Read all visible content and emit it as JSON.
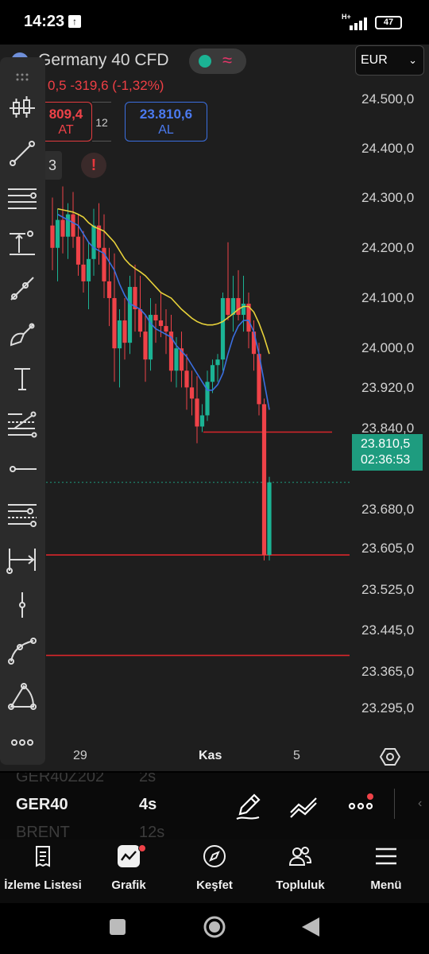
{
  "status_bar": {
    "time": "14:23",
    "network": "H+",
    "battery": "47"
  },
  "instrument": {
    "name": "Germany 40 CFD",
    "change": "0,5  -319,6 (-1,32%)",
    "sell_price": "809,4",
    "sell_label": "AT",
    "spread": "12",
    "buy_price": "23.810,6",
    "buy_label": "AL",
    "chip": "3",
    "alert": "!"
  },
  "currency": {
    "selected": "EUR"
  },
  "price_axis": {
    "labels": [
      "24.500,0",
      "24.400,0",
      "24.300,0",
      "24.200,0",
      "24.100,0",
      "24.000,0",
      "23.920,0",
      "23.840,0",
      "23.680,0",
      "23.605,0",
      "23.525,0",
      "23.445,0",
      "23.365,0",
      "23.295,0"
    ],
    "current_price": "23.810,5",
    "countdown": "02:36:53"
  },
  "time_axis": {
    "labels": [
      "29",
      "Kas",
      "5"
    ]
  },
  "chart_data": {
    "type": "candlestick",
    "ylim": [
      23250,
      24560
    ],
    "candles": [
      {
        "o": 24270,
        "h": 24320,
        "l": 24190,
        "c": 24230
      },
      {
        "o": 24230,
        "h": 24300,
        "l": 24170,
        "c": 24280
      },
      {
        "o": 24280,
        "h": 24340,
        "l": 24220,
        "c": 24250
      },
      {
        "o": 24250,
        "h": 24310,
        "l": 24210,
        "c": 24290
      },
      {
        "o": 24290,
        "h": 24330,
        "l": 24230,
        "c": 24250
      },
      {
        "o": 24250,
        "h": 24290,
        "l": 24180,
        "c": 24200
      },
      {
        "o": 24200,
        "h": 24260,
        "l": 24150,
        "c": 24170
      },
      {
        "o": 24170,
        "h": 24240,
        "l": 24120,
        "c": 24210
      },
      {
        "o": 24210,
        "h": 24300,
        "l": 24180,
        "c": 24270
      },
      {
        "o": 24270,
        "h": 24310,
        "l": 24200,
        "c": 24230
      },
      {
        "o": 24230,
        "h": 24290,
        "l": 24140,
        "c": 24170
      },
      {
        "o": 24170,
        "h": 24230,
        "l": 24090,
        "c": 24140
      },
      {
        "o": 24140,
        "h": 24220,
        "l": 23990,
        "c": 24050
      },
      {
        "o": 24050,
        "h": 24120,
        "l": 23980,
        "c": 24100
      },
      {
        "o": 24100,
        "h": 24140,
        "l": 24030,
        "c": 24060
      },
      {
        "o": 24060,
        "h": 24180,
        "l": 24040,
        "c": 24160
      },
      {
        "o": 24160,
        "h": 24200,
        "l": 24080,
        "c": 24120
      },
      {
        "o": 24120,
        "h": 24180,
        "l": 24070,
        "c": 24080
      },
      {
        "o": 24080,
        "h": 24110,
        "l": 23990,
        "c": 24030
      },
      {
        "o": 24030,
        "h": 24140,
        "l": 24010,
        "c": 24110
      },
      {
        "o": 24110,
        "h": 24130,
        "l": 24060,
        "c": 24100
      },
      {
        "o": 24100,
        "h": 24150,
        "l": 24070,
        "c": 24090
      },
      {
        "o": 24090,
        "h": 24120,
        "l": 24040,
        "c": 24080
      },
      {
        "o": 24080,
        "h": 24110,
        "l": 23990,
        "c": 24010
      },
      {
        "o": 24010,
        "h": 24070,
        "l": 23980,
        "c": 24050
      },
      {
        "o": 24050,
        "h": 24080,
        "l": 23980,
        "c": 24010
      },
      {
        "o": 24010,
        "h": 24040,
        "l": 23940,
        "c": 23980
      },
      {
        "o": 23980,
        "h": 24010,
        "l": 23930,
        "c": 23960
      },
      {
        "o": 23960,
        "h": 24000,
        "l": 23880,
        "c": 23910
      },
      {
        "o": 23910,
        "h": 23950,
        "l": 23900,
        "c": 23930
      },
      {
        "o": 23930,
        "h": 24010,
        "l": 23920,
        "c": 23990
      },
      {
        "o": 23990,
        "h": 24030,
        "l": 23970,
        "c": 24020
      },
      {
        "o": 24020,
        "h": 24040,
        "l": 23990,
        "c": 24030
      },
      {
        "o": 24030,
        "h": 24150,
        "l": 24010,
        "c": 24140
      },
      {
        "o": 24140,
        "h": 24240,
        "l": 24100,
        "c": 24110
      },
      {
        "o": 24110,
        "h": 24180,
        "l": 24080,
        "c": 24140
      },
      {
        "o": 24140,
        "h": 24190,
        "l": 24100,
        "c": 24110
      },
      {
        "o": 24110,
        "h": 24180,
        "l": 24080,
        "c": 24130
      },
      {
        "o": 24130,
        "h": 24150,
        "l": 24050,
        "c": 24080
      },
      {
        "o": 24080,
        "h": 24100,
        "l": 24010,
        "c": 24040
      },
      {
        "o": 24040,
        "h": 24060,
        "l": 23930,
        "c": 23950
      },
      {
        "o": 23950,
        "h": 23960,
        "l": 23670,
        "c": 23680
      },
      {
        "o": 23680,
        "h": 23820,
        "l": 23670,
        "c": 23810
      }
    ],
    "ma_fast": [
      24290,
      24285,
      24280,
      24275,
      24270,
      24255,
      24240,
      24230,
      24225,
      24220,
      24205,
      24190,
      24165,
      24145,
      24130,
      24125,
      24120,
      24110,
      24095,
      24085,
      24080,
      24075,
      24070,
      24055,
      24045,
      24035,
      24020,
      24005,
      23990,
      23975,
      23975,
      23985,
      24005,
      24040,
      24070,
      24090,
      24100,
      24100,
      24080,
      24040,
      23990,
      23940
    ],
    "ma_slow": [
      24300,
      24298,
      24296,
      24294,
      24290,
      24285,
      24275,
      24268,
      24264,
      24260,
      24250,
      24240,
      24225,
      24210,
      24200,
      24193,
      24187,
      24180,
      24170,
      24160,
      24150,
      24145,
      24140,
      24130,
      24120,
      24112,
      24104,
      24098,
      24094,
      24092,
      24092,
      24094,
      24098,
      24105,
      24112,
      24120,
      24125,
      24125,
      24115,
      24095,
      24070,
      24040
    ],
    "hlines": [
      23900,
      23680,
      23500
    ],
    "current_price_line": 23810
  },
  "toolbar": {
    "more": "ooo"
  },
  "watchlist": {
    "rows": [
      {
        "symbol": "GER40Z202",
        "period": "2s"
      },
      {
        "symbol": "GER40",
        "period": "4s"
      },
      {
        "symbol": "BRENT",
        "period": "12s"
      }
    ]
  },
  "bottom_nav": {
    "items": [
      {
        "label": "İzleme Listesi",
        "icon": "list-icon"
      },
      {
        "label": "Grafik",
        "icon": "chart-icon"
      },
      {
        "label": "Keşfet",
        "icon": "compass-icon"
      },
      {
        "label": "Topluluk",
        "icon": "community-icon"
      },
      {
        "label": "Menü",
        "icon": "menu-icon"
      }
    ]
  },
  "colors": {
    "up": "#1bb394",
    "down": "#ef4248",
    "ma_fast": "#3b6fe0",
    "ma_slow": "#e8d23a",
    "hline": "#d8262b",
    "price_tag": "#1e9c7f"
  }
}
